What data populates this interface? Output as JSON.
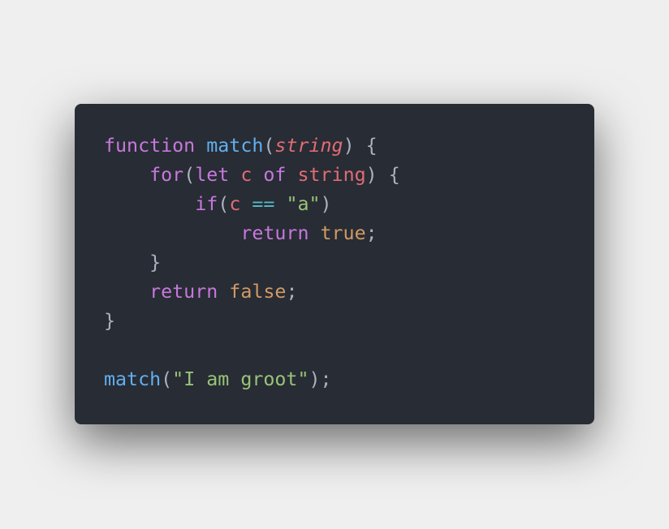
{
  "code": {
    "line1": {
      "kw_function": "function",
      "fn_name": "match",
      "open_paren": "(",
      "param": "string",
      "close_brace": ") {"
    },
    "line2": {
      "indent": "    ",
      "kw_for": "for",
      "open_paren": "(",
      "kw_let": "let",
      "var_c": "c",
      "kw_of": "of",
      "var_string": "string",
      "close_brace": ") {"
    },
    "line3": {
      "indent": "        ",
      "kw_if": "if",
      "open_paren": "(",
      "var_c": "c",
      "op_eq": "==",
      "str_a": "\"a\"",
      "close_paren": ")"
    },
    "line4": {
      "indent": "            ",
      "kw_return": "return",
      "bool_true": "true",
      "semicolon": ";"
    },
    "line5": {
      "indent": "    ",
      "close_brace": "}"
    },
    "line6": {
      "indent": "    ",
      "kw_return": "return",
      "bool_false": "false",
      "semicolon": ";"
    },
    "line7": {
      "close_brace": "}"
    },
    "line9": {
      "fn_name": "match",
      "open_paren": "(",
      "str_arg": "\"I am groot\"",
      "close": ");"
    }
  }
}
